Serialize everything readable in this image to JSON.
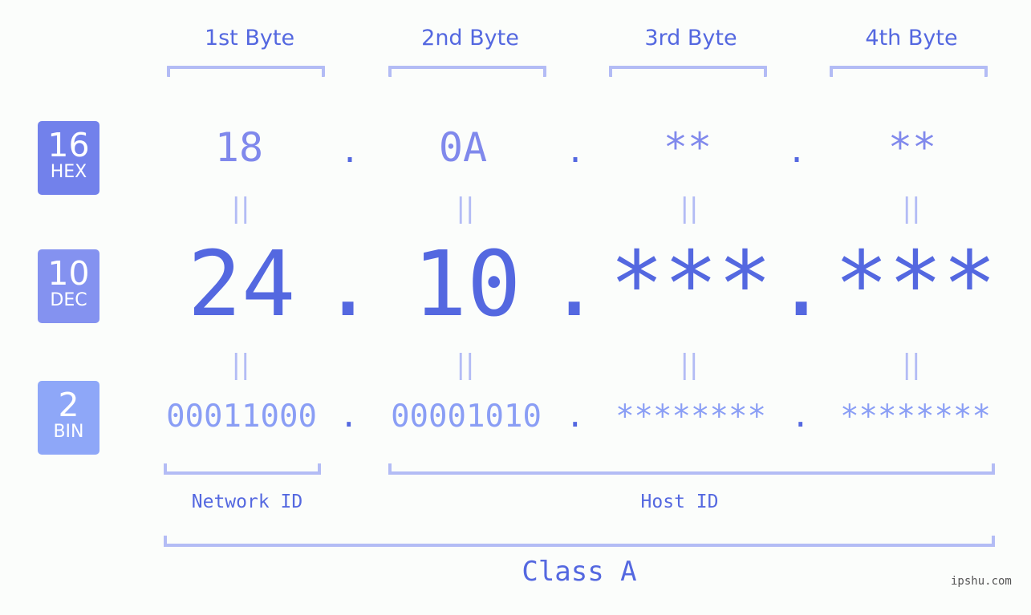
{
  "byte_headers": [
    "1st Byte",
    "2nd Byte",
    "3rd Byte",
    "4th Byte"
  ],
  "badges": [
    {
      "num": "16",
      "label": "HEX",
      "color": "#7281eb"
    },
    {
      "num": "10",
      "label": "DEC",
      "color": "#8492f0"
    },
    {
      "num": "2",
      "label": "BIN",
      "color": "#8ea7f8"
    }
  ],
  "hex": [
    "18",
    "0A",
    "**",
    "**"
  ],
  "dec": [
    "24",
    "10",
    "***",
    "***"
  ],
  "bin": [
    "00011000",
    "00001010",
    "********",
    "********"
  ],
  "separator": ".",
  "equals": "||",
  "network_label": "Network ID",
  "host_label": "Host ID",
  "class_label": "Class A",
  "watermark": "ipshu.com",
  "colors": {
    "accent": "#5468e0",
    "bracket": "#b3bcf5"
  }
}
